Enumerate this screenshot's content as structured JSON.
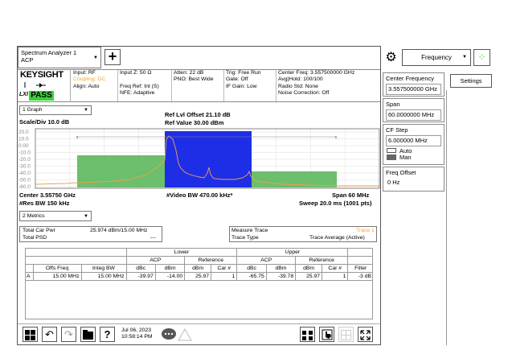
{
  "mode": {
    "line1": "Spectrum Analyzer 1",
    "line2": "ACP"
  },
  "add_btn": "+",
  "brand": "KEYSIGHT",
  "status_pass": "PASS",
  "lxi": "LXI",
  "info": {
    "input": "Input: RF",
    "coupling": "Coupling: DC",
    "align": "Align: Auto",
    "inputz": "Input Z: 50 Ω",
    "freqref": "Freq Ref: Int (S)",
    "nfe": "NFE: Adaptive",
    "atten": "Atten: 22 dB",
    "pno": "PNO: Best Wide",
    "trig": "Trig: Free Run",
    "gate": "Gate: Off",
    "ifgain": "IF Gain: Low",
    "center": "Center Freq: 3.557500000 GHz",
    "avg": "Avg|Hold: 100/100",
    "radio": "Radio Std: None",
    "noise": "Noise Correction: Off"
  },
  "graph_sel": "1 Graph",
  "scale": "Scale/Div 10.0 dB",
  "ref_offset": "Ref Lvl Offset 21.10 dB",
  "ref_value": "Ref Value 30.00 dBm",
  "y_ticks": [
    "20.0",
    "10.0",
    "0.00",
    "-10.0",
    "-20.0",
    "-30.0",
    "-40.0",
    "-50.0",
    "-60.0"
  ],
  "footer": {
    "center": "Center 3.55750 GHz",
    "vbw": "#Video BW 470.00 kHz*",
    "span": "Span 60 MHz",
    "rbw": "#Res BW 150 kHz",
    "sweep": "Sweep 20.0 ms (1001 pts)"
  },
  "metrics_sel": "2 Metrics",
  "summary": {
    "car_pwr_label": "Total Car Pwr",
    "car_pwr_value": "25.974 dBm/15.00 MHz",
    "psd_label": "Total PSD",
    "psd_value": "---",
    "measure_trace_label": "Measure Trace",
    "measure_trace_value": "Trace 1",
    "trace_type_label": "Trace Type",
    "trace_type_value": "Trace Average (Active)"
  },
  "table": {
    "lower": "Lower",
    "upper": "Upper",
    "acp": "ACP",
    "reference": "Reference",
    "offs_freq": "Offs Freq",
    "integ_bw": "Integ BW",
    "dbc": "dBc",
    "dbm": "dBm",
    "car": "Car #",
    "filter": "Filter",
    "row": [
      "A",
      "15.00 MHz",
      "15.00 MHz",
      "-39.97",
      "-14.00",
      "25.97",
      "1",
      "-65.75",
      "-39.78",
      "25.97",
      "1",
      "-3 dB"
    ]
  },
  "taskbar": {
    "date": "Jul 06, 2023",
    "time": "10:58:14 PM"
  },
  "panel": {
    "menu": "Frequency",
    "settings": "Settings",
    "center_label": "Center Frequency",
    "center_value": "3.557500000 GHz",
    "span_label": "Span",
    "span_value": "60.0000000 MHz",
    "cfstep_label": "CF Step",
    "cfstep_value": "6.000000 MHz",
    "auto": "Auto",
    "man": "Man",
    "offset_label": "Freq Offset",
    "offset_value": "0 Hz"
  },
  "colors": {
    "pass": "#3ad13a",
    "channel": "#1e2ee6",
    "adjacent": "#5cb85c",
    "trace": "#f0a050",
    "orange": "#f5a623"
  }
}
